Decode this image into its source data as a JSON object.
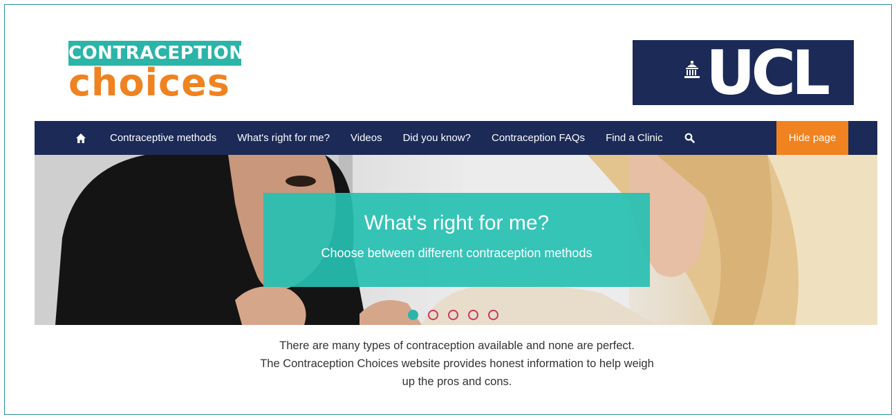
{
  "logo": {
    "top_text": "CONTRACEPTION",
    "bottom_text": "choices"
  },
  "partner_logo": {
    "text": "UCL",
    "icon": "portico-icon"
  },
  "nav": {
    "home_icon": "home-icon",
    "items": [
      {
        "label": "Contraceptive methods"
      },
      {
        "label": "What's right for me?"
      },
      {
        "label": "Videos"
      },
      {
        "label": "Did you know?"
      },
      {
        "label": "Contraception FAQs"
      },
      {
        "label": "Find a Clinic"
      }
    ],
    "search_icon": "search-icon",
    "hide_label": "Hide page"
  },
  "hero": {
    "title": "What's right for me?",
    "subtitle": "Choose between different contraception methods",
    "slides_total": 5,
    "active_slide": 1
  },
  "intro": {
    "line1": "There are many types of contraception available and none are perfect.",
    "line2": "The Contraception Choices website provides honest information to help weigh",
    "line3": "up the pros and cons."
  },
  "colors": {
    "navy": "#1b2a57",
    "teal": "#2ab5a8",
    "orange": "#f0821f",
    "dot_pink": "#c8385d"
  }
}
